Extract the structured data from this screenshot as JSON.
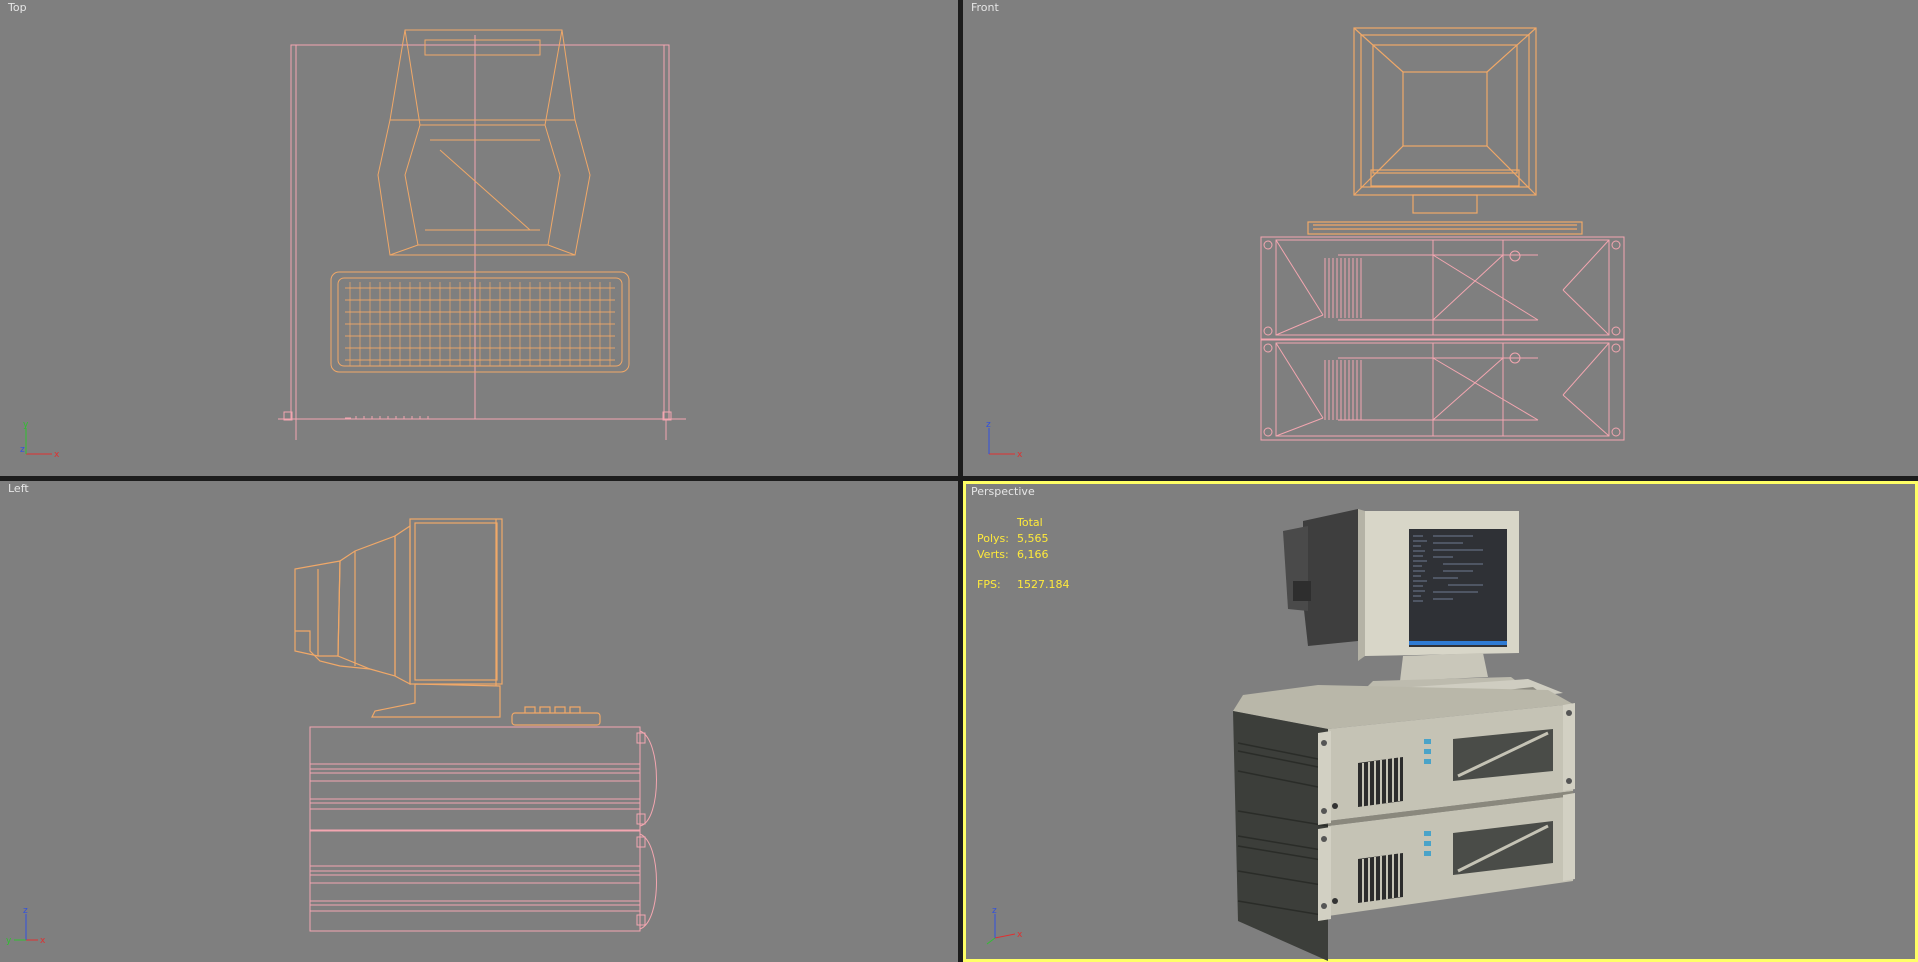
{
  "viewports": {
    "top": {
      "label": "Top"
    },
    "front": {
      "label": "Front"
    },
    "left": {
      "label": "Left"
    },
    "perspective": {
      "label": "Perspective"
    }
  },
  "stats": {
    "header": "Total",
    "polys_label": "Polys:",
    "polys_value": "5,565",
    "verts_label": "Verts:",
    "verts_value": "6,166",
    "fps_label": "FPS:",
    "fps_value": "1527.184"
  },
  "axis_labels": {
    "x": "x",
    "y": "y",
    "z": "z"
  },
  "colors": {
    "viewport_bg": "#7f7f7f",
    "wire_orange": "#f0a868",
    "wire_pink": "#f3a6b0",
    "active_border": "#ffff66",
    "stats_text": "#ffea3a"
  }
}
